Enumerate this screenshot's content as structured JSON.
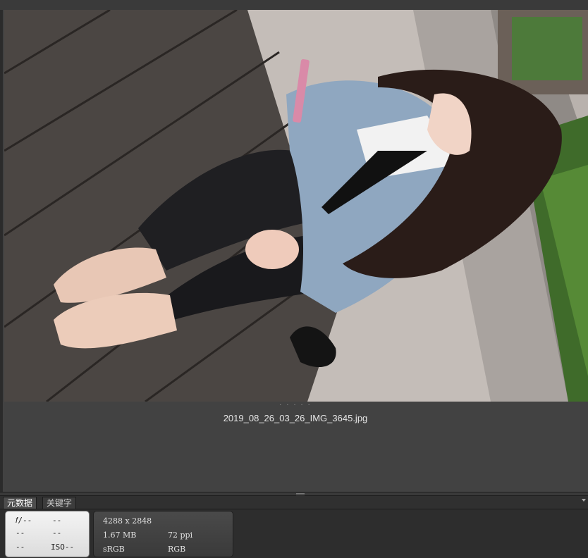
{
  "preview": {
    "filename": "2019_08_26_03_26_IMG_3645.jpg",
    "dots": "· · · · ·",
    "photo_description_icon": "photo-thumbnail"
  },
  "tabs": [
    {
      "label": "元数据",
      "active": true
    },
    {
      "label": "关键字",
      "active": false
    }
  ],
  "camera": {
    "aperture": "𝑓/--",
    "shutter": "--",
    "row2_left": "--",
    "row2_right": "--",
    "row3_left": "--",
    "iso": "ISO--"
  },
  "file_info": {
    "dimensions": "4288 x 2848",
    "size": "1.67 MB",
    "resolution": "72 ppi",
    "color_profile": "sRGB",
    "color_mode": "RGB"
  },
  "colors": {
    "panel_bg": "#424242",
    "dark_bg": "#2b2b2b",
    "tab_active": "#4d4d4d"
  }
}
